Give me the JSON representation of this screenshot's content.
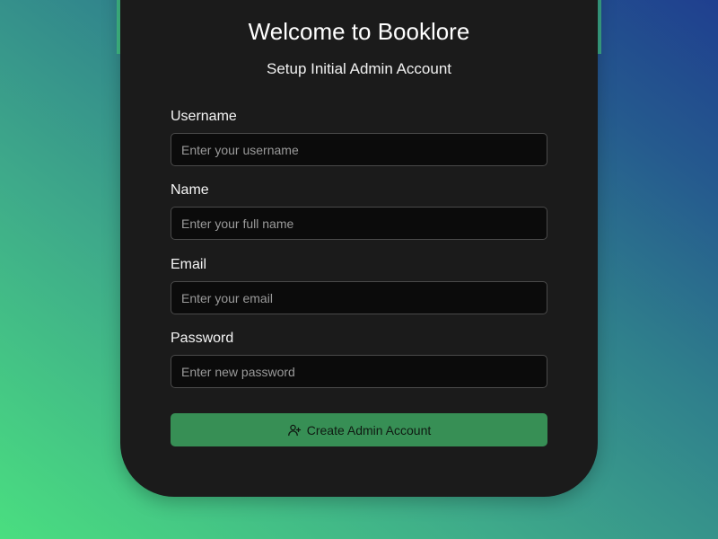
{
  "page": {
    "title": "Welcome to Booklore",
    "subtitle": "Setup Initial Admin Account"
  },
  "form": {
    "fields": [
      {
        "label": "Username",
        "placeholder": "Enter your username",
        "value": ""
      },
      {
        "label": "Name",
        "placeholder": "Enter your full name",
        "value": ""
      },
      {
        "label": "Email",
        "placeholder": "Enter your email",
        "value": ""
      },
      {
        "label": "Password",
        "placeholder": "Enter new password",
        "value": ""
      }
    ],
    "submit": {
      "label": "Create Admin Account",
      "icon": "user-plus-icon"
    }
  },
  "colors": {
    "accent": "#378f55",
    "card_background": "#1b1b1b",
    "input_background": "#0b0b0b"
  }
}
